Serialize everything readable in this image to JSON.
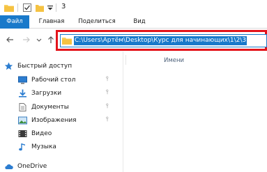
{
  "window": {
    "title": "3",
    "quick_access_icons": [
      "folder-icon",
      "checkbox-icon",
      "new-folder-icon",
      "dropdown-icon"
    ]
  },
  "ribbon": {
    "tabs": [
      "Файл",
      "Главная",
      "Поделиться",
      "Вид"
    ]
  },
  "navigation": {
    "back_icon": "arrow-left-icon",
    "forward_icon": "arrow-right-icon",
    "recent_icon": "chevron-down-icon",
    "up_icon": "arrow-up-icon"
  },
  "address_bar": {
    "value": "C:\\Users\\Артём\\Desktop\\Курс для начинающих\\1\\2\\3",
    "highlight_color": "#e3141b",
    "selection_color": "#1979ca"
  },
  "sidebar": {
    "quick_access": "Быстрый доступ",
    "items": [
      {
        "label": "Рабочий стол",
        "icon": "desktop-icon",
        "pinned": true
      },
      {
        "label": "Загрузки",
        "icon": "download-icon",
        "pinned": true
      },
      {
        "label": "Документы",
        "icon": "documents-icon",
        "pinned": true
      },
      {
        "label": "Изображения",
        "icon": "pictures-icon",
        "pinned": true
      },
      {
        "label": "Видео",
        "icon": "video-icon",
        "pinned": false
      },
      {
        "label": "Музыка",
        "icon": "music-icon",
        "pinned": false
      }
    ],
    "onedrive": "OneDrive"
  },
  "content": {
    "column_name": "Имени"
  }
}
